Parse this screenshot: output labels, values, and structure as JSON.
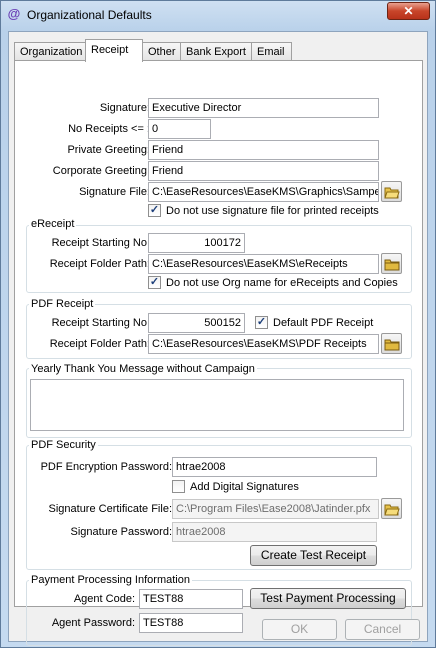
{
  "window": {
    "title": "Organizational Defaults",
    "close_label": "✕"
  },
  "tabs": [
    {
      "label": "Organization"
    },
    {
      "label": "Receipt"
    },
    {
      "label": "Other"
    },
    {
      "label": "Bank Export"
    },
    {
      "label": "Email"
    }
  ],
  "receipt": {
    "signature_label": "Signature:",
    "signature_value": "Executive Director",
    "no_receipts_label": "No Receipts <= :",
    "no_receipts_value": "0",
    "private_greeting_label": "Private Greeting:",
    "private_greeting_value": "Friend",
    "corporate_greeting_label": "Corporate Greeting:",
    "corporate_greeting_value": "Friend",
    "signature_file_label": "Signature File:",
    "signature_file_value": "C:\\EaseResources\\EaseKMS\\Graphics\\Sampe",
    "no_sig_file_label": "Do not use signature file for printed receipts",
    "no_sig_file_checked": true
  },
  "ereceipt": {
    "group_title": "eReceipt",
    "starting_no_label": "Receipt Starting No:",
    "starting_no_value": "100172",
    "folder_label": "Receipt Folder Path:",
    "folder_value": "C:\\EaseResources\\EaseKMS\\eReceipts",
    "no_org_name_label": "Do not use Org name for eReceipts and Copies",
    "no_org_name_checked": true
  },
  "pdf_receipt": {
    "group_title": "PDF Receipt",
    "starting_no_label": "Receipt Starting No:",
    "starting_no_value": "500152",
    "default_label": "Default PDF Receipt",
    "default_checked": true,
    "folder_label": "Receipt Folder Path:",
    "folder_value": "C:\\EaseResources\\EaseKMS\\PDF Receipts"
  },
  "thank_you": {
    "group_title": "Yearly Thank You Message without Campaign",
    "value": ""
  },
  "pdf_security": {
    "group_title": "PDF Security",
    "encryption_label": "PDF Encryption Password:",
    "encryption_value": "htrae2008",
    "add_sig_label": "Add Digital Signatures",
    "add_sig_checked": false,
    "cert_file_label": "Signature Certificate File:",
    "cert_file_value": "C:\\Program Files\\Ease2008\\Jatinder.pfx",
    "sig_password_label": "Signature Password:",
    "sig_password_value": "htrae2008",
    "create_test_label": "Create Test Receipt"
  },
  "payment": {
    "group_title": "Payment Processing Information",
    "agent_code_label": "Agent Code:",
    "agent_code_value": "TEST88",
    "agent_password_label": "Agent Password:",
    "agent_password_value": "TEST88",
    "test_label": "Test Payment Processing"
  },
  "footer": {
    "ok_label": "OK",
    "cancel_label": "Cancel"
  }
}
